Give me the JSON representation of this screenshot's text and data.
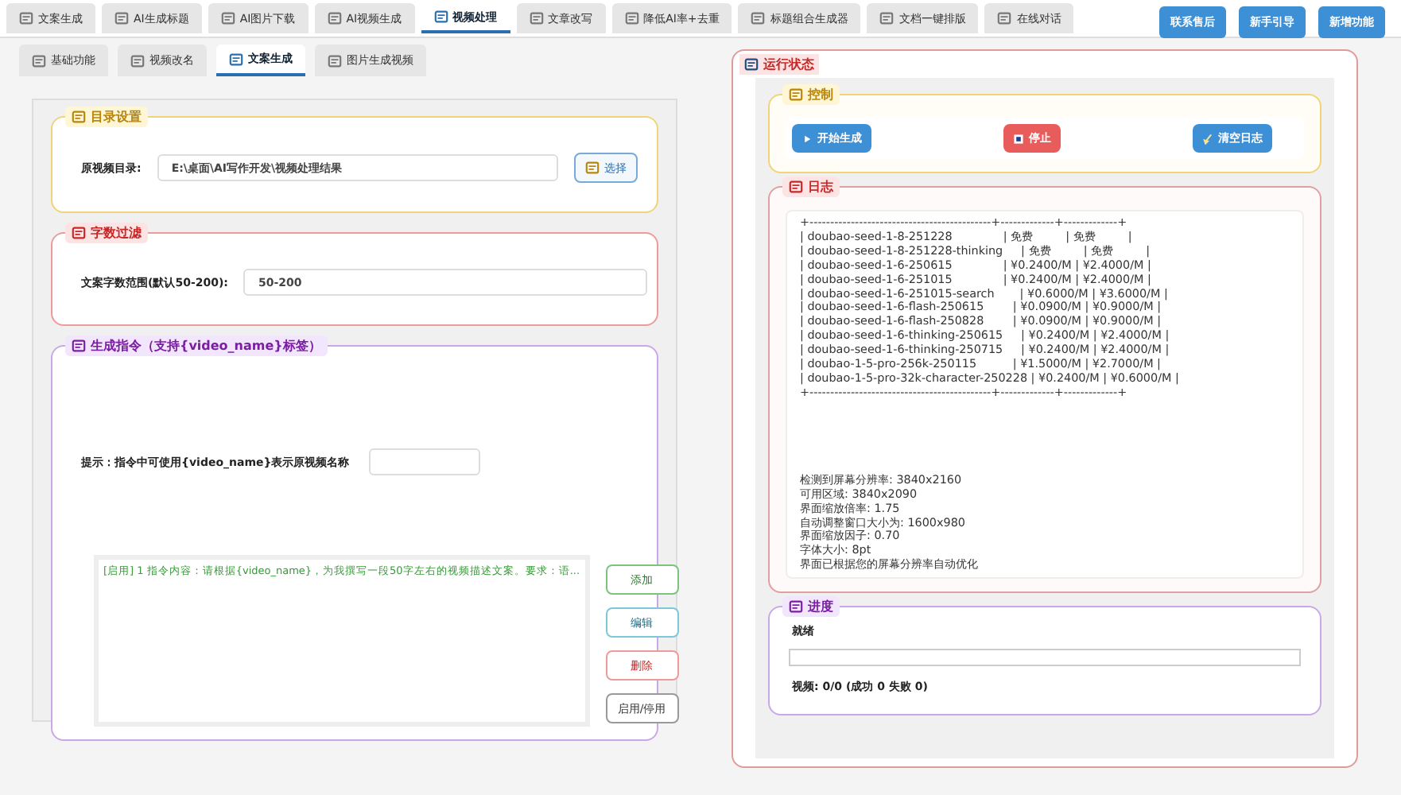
{
  "main_tabs": [
    {
      "label": "文案生成",
      "selected": false
    },
    {
      "label": "AI生成标题",
      "selected": false
    },
    {
      "label": "AI图片下载",
      "selected": false
    },
    {
      "label": "AI视频生成",
      "selected": false
    },
    {
      "label": "视频处理",
      "selected": true
    },
    {
      "label": "文章改写",
      "selected": false
    },
    {
      "label": "降低AI率+去重",
      "selected": false
    },
    {
      "label": "标题组合生成器",
      "selected": false
    },
    {
      "label": "文档一键排版",
      "selected": false
    },
    {
      "label": "在线对话",
      "selected": false
    }
  ],
  "header_buttons": [
    "联系售后",
    "新手引导",
    "新增功能"
  ],
  "sub_tabs": [
    {
      "label": "基础功能",
      "selected": false
    },
    {
      "label": "视频改名",
      "selected": false
    },
    {
      "label": "文案生成",
      "selected": true
    },
    {
      "label": "图片生成视频",
      "selected": false
    }
  ],
  "directory": {
    "title": "目录设置",
    "label": "原视频目录:",
    "value": "E:\\桌面\\AI写作开发\\视频处理结果",
    "button": "选择"
  },
  "word_filter": {
    "title": "字数过滤",
    "label": "文案字数范围(默认50-200):",
    "value": "50-200"
  },
  "instructions": {
    "title": "生成指令（支持{video_name}标签）",
    "hint": "提示：指令中可使用{video_name}表示原视频名称",
    "items": [
      "[启用] 1  指令内容：请根据{video_name}，为我撰写一段50字左右的视频描述文案。要求：语..."
    ],
    "buttons": [
      "添加",
      "编辑",
      "删除",
      "启用/停用"
    ]
  },
  "status": {
    "title": "运行状态",
    "control": {
      "title": "控制",
      "buttons": [
        "开始生成",
        "停止",
        "清空日志"
      ]
    },
    "log": {
      "title": "日志",
      "lines": [
        "+--------------------------------------------+-------------+-------------+",
        "| doubao-seed-1-8-251228              | 免费         | 免费         |",
        "| doubao-seed-1-8-251228-thinking     | 免费         | 免费         |",
        "| doubao-seed-1-6-250615              | ¥0.2400/M | ¥2.4000/M |",
        "| doubao-seed-1-6-251015              | ¥0.2400/M | ¥2.4000/M |",
        "| doubao-seed-1-6-251015-search       | ¥0.6000/M | ¥3.6000/M |",
        "| doubao-seed-1-6-flash-250615        | ¥0.0900/M | ¥0.9000/M |",
        "| doubao-seed-1-6-flash-250828        | ¥0.0900/M | ¥0.9000/M |",
        "| doubao-seed-1-6-thinking-250615     | ¥0.2400/M | ¥2.4000/M |",
        "| doubao-seed-1-6-thinking-250715     | ¥0.2400/M | ¥2.4000/M |",
        "| doubao-1-5-pro-256k-250115          | ¥1.5000/M | ¥2.7000/M |",
        "| doubao-1-5-pro-32k-character-250228 | ¥0.2400/M | ¥0.6000/M |",
        "+--------------------------------------------+-------------+-------------+"
      ],
      "info_lines": [
        "检测到屏幕分辨率: 3840x2160",
        "可用区域: 3840x2090",
        "界面缩放倍率: 1.75",
        "自动调整窗口大小为: 1600x980",
        "界面缩放因子: 0.70",
        "字体大小: 8pt",
        "界面已根据您的屏幕分辨率自动优化"
      ]
    },
    "progress": {
      "title": "进度",
      "state": "就绪",
      "level": 0,
      "summary": "视频: 0/0 (成功 0 失败 0)"
    }
  }
}
